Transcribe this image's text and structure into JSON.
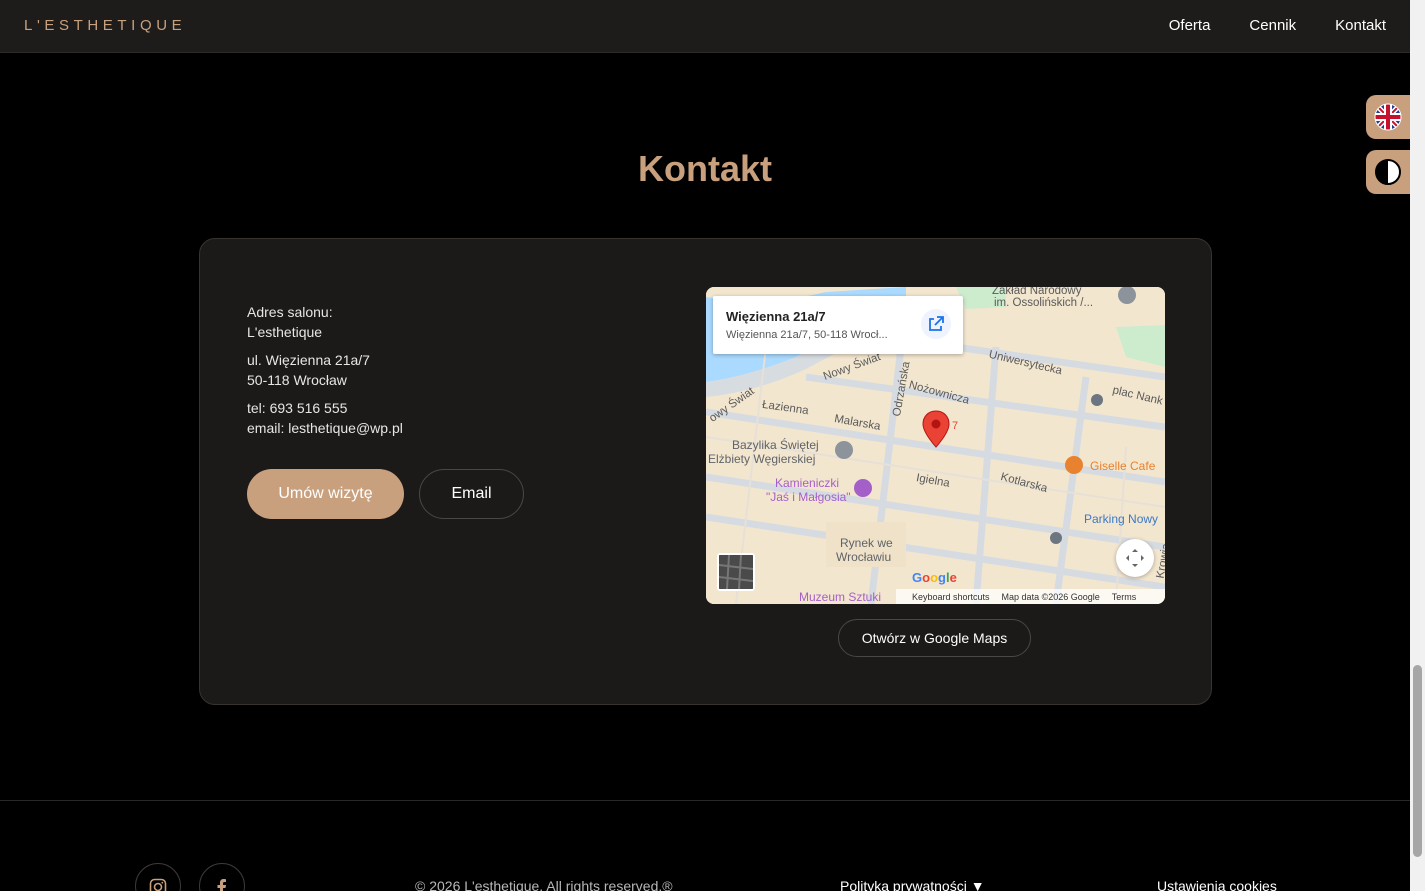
{
  "header": {
    "brand": "L'ESTHETIQUE",
    "nav": [
      "Oferta",
      "Cennik",
      "Kontakt"
    ]
  },
  "side_buttons": {
    "language_icon": "uk-flag-icon",
    "contrast_icon": "contrast-icon"
  },
  "contact": {
    "title": "Kontakt",
    "address_label": "Adres salonu:",
    "salon_name": "L'esthetique",
    "street": "ul. Więzienna 21a/7",
    "city": "50-118 Wrocław",
    "phone": "tel: 693 516 555",
    "email": "email: lesthetique@wp.pl",
    "book_button": "Umów wizytę",
    "email_button": "Email",
    "maps_button": "Otwórz w Google Maps"
  },
  "map": {
    "place_title": "Więzienna 21a/7",
    "place_address": "Więzienna 21a/7, 50-118 Wrocł...",
    "pin_label": "7",
    "labels": {
      "ossolineum": "Zakład Narodowy",
      "ossolineum2": "im. Ossolińskich /...",
      "uniwersytecka": "Uniwersytecka",
      "plac_nank": "plac Nank",
      "nowy_swiat": "Nowy Świat",
      "nowy_swiat2": "owy Świat",
      "odrzanska": "Odrzańska",
      "nozownicza": "Nożownicza",
      "lazienna": "Łazienna",
      "malarska": "Malarska",
      "bazylika1": "Bazylika Świętej",
      "bazylika2": "Elżbiety Węgierskiej",
      "kotlarska": "Kotlarska",
      "giselle": "Giselle Cafe",
      "kamieniczki1": "Kamieniczki",
      "kamieniczki2": "\"Jaś i Małgosia\"",
      "igielna": "Igielna",
      "parking": "Parking Nowy",
      "rynek1": "Rynek we",
      "rynek2": "Wrocławiu",
      "muzeum": "Muzeum Sztuki",
      "krowia": "Krowia"
    },
    "google_logo": "Google",
    "attribution": {
      "shortcuts": "Keyboard shortcuts",
      "data": "Map data ©2026 Google",
      "terms": "Terms"
    }
  },
  "footer": {
    "copyright": "© 2026 L'esthetique. All rights reserved.®",
    "privacy": "Polityka prywatności",
    "privacy_arrow": "▼",
    "cookies": "Ustawienia cookies",
    "social": [
      "instagram-icon",
      "facebook-icon"
    ]
  },
  "colors": {
    "accent": "#c9a07d",
    "background": "#000000",
    "card": "#1c1a19"
  }
}
